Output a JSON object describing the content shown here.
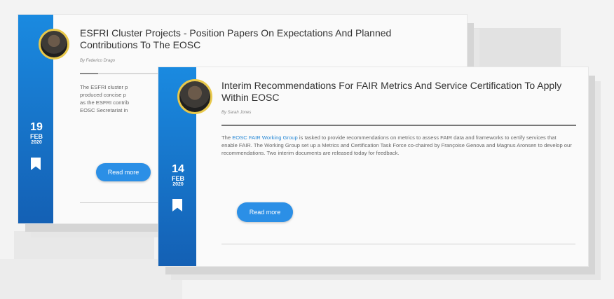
{
  "cards": [
    {
      "title": "ESFRI Cluster Projects - Position Papers On Expectations And Planned Contributions To The EOSC",
      "author": "By Federico Drago",
      "excerpt_lines": [
        "The ESFRI cluster p",
        "produced concise p",
        "as the ESFRI contrib",
        "EOSC Secretariat in"
      ],
      "date": {
        "day": "19",
        "month": "FEB",
        "year": "2020"
      },
      "read_more": "Read more"
    },
    {
      "title": "Interim Recommendations For FAIR Metrics And Service Certification To Apply Within EOSC",
      "author": "By Sarah Jones",
      "body_prefix": "The ",
      "body_link": "EOSC FAIR Working Group",
      "body_rest": " is tasked to provide recommendations on metrics to assess FAIR data and frameworks to certify services that enable FAIR. The Working Group set up a Metrics and Certification Task Force co-chaired by Françoise Genova and Magnus Aronsen to develop our recommendations. Two interim documents are released today for feedback.",
      "date": {
        "day": "14",
        "month": "FEB",
        "year": "2020"
      },
      "read_more": "Read more"
    }
  ],
  "colors": {
    "accent": "#2b8fe6",
    "strip_top": "#1a8ae0",
    "strip_bottom": "#1460b4",
    "avatar_ring": "#e8c84a"
  }
}
